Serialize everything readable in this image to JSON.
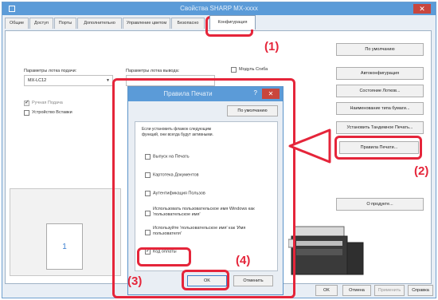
{
  "window": {
    "title": "Свойства SHARP MX-xxxx",
    "close": "✕"
  },
  "tabs": [
    {
      "label": "Общие"
    },
    {
      "label": "Доступ"
    },
    {
      "label": "Порты"
    },
    {
      "label": "Дополнительно"
    },
    {
      "label": "Управление цветом"
    },
    {
      "label": "Безопасно"
    },
    {
      "label": "Конфигурация"
    }
  ],
  "panel": {
    "feed_tray_label": "Параметры лотка подачи:",
    "feed_tray_value": "MX-LC12",
    "output_tray_label": "Параметры лотка вывода:",
    "stapler_label": "Модуль Сгиба",
    "manual_feed_label": "Ручная Подача",
    "insertion_label": "Устройство Вставки"
  },
  "right_buttons": [
    {
      "label": "По умолчанию"
    },
    {
      "label": "Автоконфигурация"
    },
    {
      "label": "Состояние Лотков..."
    },
    {
      "label": "Наименование типа бумаги..."
    },
    {
      "label": "Установить Тандемное Печать..."
    },
    {
      "label": "Правила Печати..."
    },
    {
      "label": "О продукте..."
    }
  ],
  "preview": {
    "page_number": "1"
  },
  "bottom_buttons": [
    {
      "label": "OK"
    },
    {
      "label": "Отмена"
    },
    {
      "label": "Применить"
    },
    {
      "label": "Справка"
    }
  ],
  "modal": {
    "title": "Правила Печати",
    "help": "?",
    "close": "✕",
    "default_button": "По умолчанию",
    "description": "Если установить флажок следующим функций, они всегда будут активными.",
    "items": [
      {
        "label": "Выпуск на Печать",
        "checked": false
      },
      {
        "label": "Картотека Документов",
        "checked": false
      },
      {
        "label": "Аутентификация Пользов",
        "checked": false
      },
      {
        "label": "Использовать пользовательское имя Windows как 'пользовательское имя'",
        "checked": false
      },
      {
        "label": "Используйте 'пользовательское имя' как 'Имя пользователя'",
        "checked": false
      },
      {
        "label": "Код оплаты",
        "checked": true
      }
    ],
    "ok": "OK",
    "cancel": "Отменить"
  },
  "callouts": {
    "c1": "(1)",
    "c2": "(2)",
    "c3": "(3)",
    "c4": "(4)"
  },
  "colors": {
    "title_bar": "#5b9bd8",
    "highlight": "#e5253a"
  }
}
